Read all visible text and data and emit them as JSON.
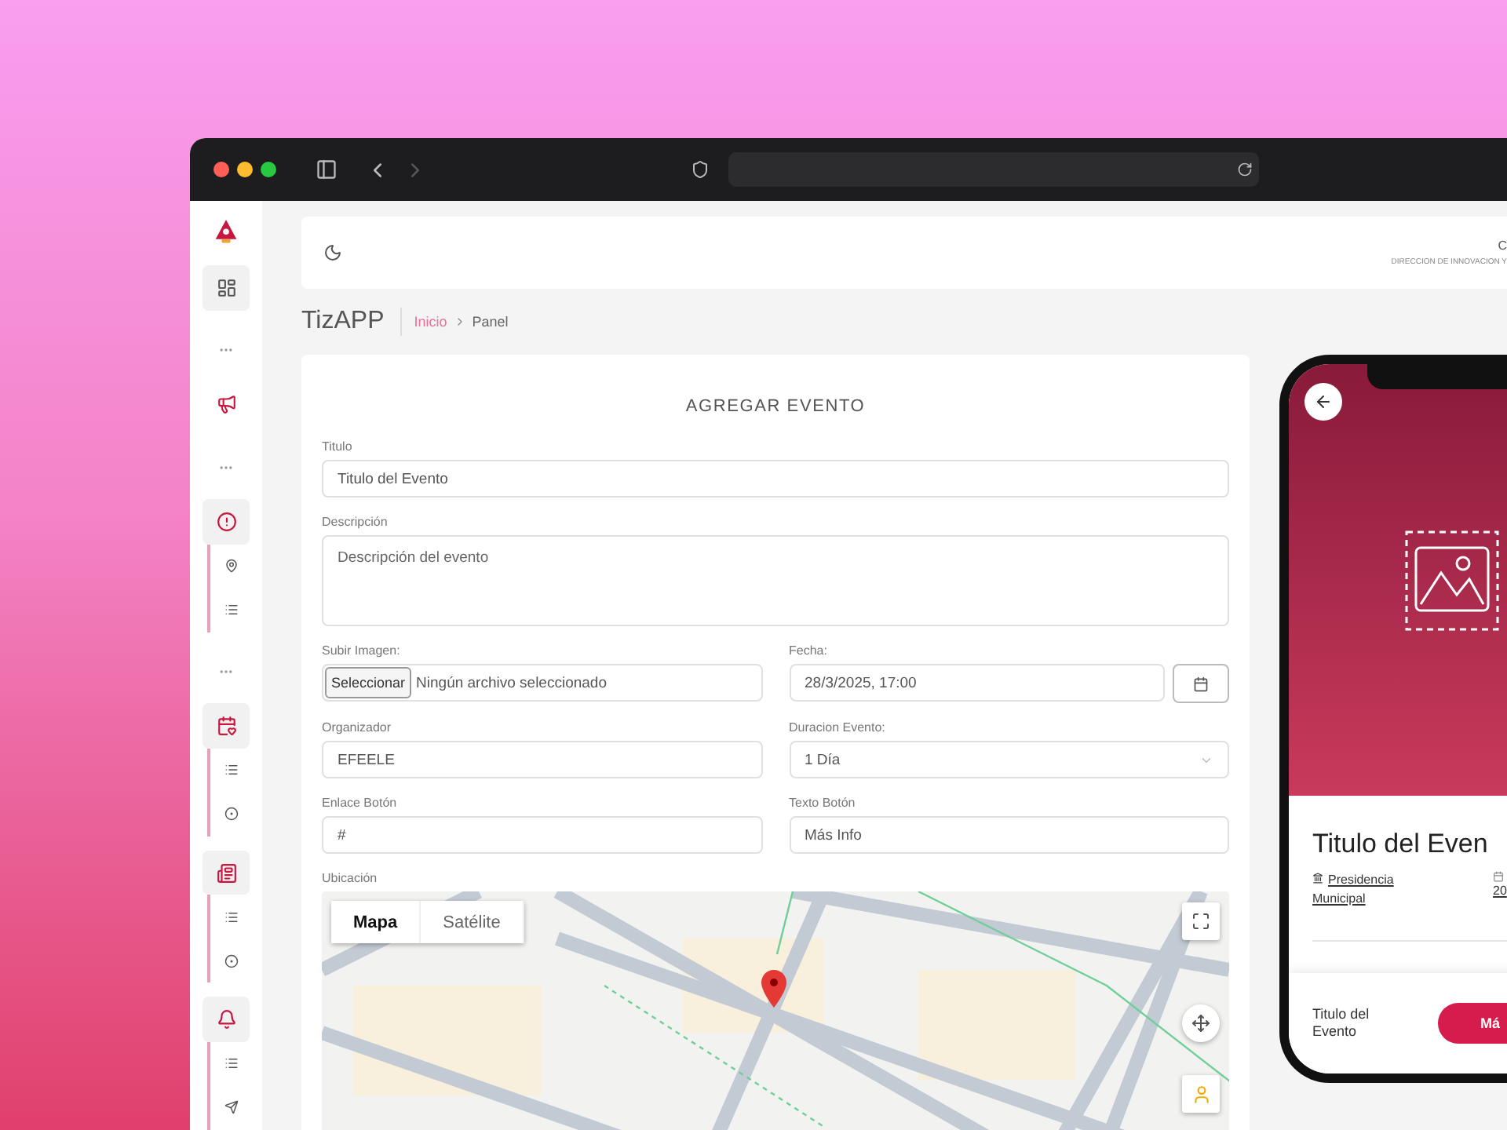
{
  "header": {
    "org_initial": "C",
    "org_subtitle": "DIRECCION DE INNOVACION Y"
  },
  "nav": [
    {
      "kind": "link",
      "selected": true
    },
    {
      "kind": "separator"
    },
    {
      "kind": "link",
      "selected": false
    },
    {
      "kind": "separator"
    },
    {
      "kind": "group",
      "expanded": true,
      "children": [
        {
          "selected": false
        },
        {
          "selected": false
        }
      ]
    },
    {
      "kind": "separator"
    },
    {
      "kind": "group",
      "expanded": true,
      "children": [
        {
          "selected": false
        },
        {
          "selected": false
        }
      ]
    },
    {
      "kind": "group",
      "expanded": true,
      "children": [
        {
          "selected": false
        },
        {
          "selected": false
        }
      ]
    },
    {
      "kind": "group",
      "expanded": true,
      "children": [
        {
          "selected": false
        },
        {
          "selected": false
        }
      ]
    }
  ],
  "breadcrumb": {
    "app": "TizAPP",
    "items": [
      {
        "label": "Inicio",
        "kind": "link"
      },
      {
        "label": "Panel",
        "kind": "current"
      }
    ]
  },
  "form": {
    "title": "AGREGAR EVENTO",
    "rows": [
      [
        {
          "kind": "text",
          "label": "Titulo",
          "value": "Titulo del Evento"
        }
      ],
      [
        {
          "kind": "textarea",
          "label": "Descripción",
          "placeholder": "Descripción del evento"
        }
      ],
      [
        {
          "kind": "file",
          "label": "Subir Imagen:",
          "button": "Seleccionar",
          "value": "Ningún archivo seleccionado"
        },
        {
          "kind": "datetime",
          "label": "Fecha:",
          "value": "28/3/2025, 17:00"
        }
      ],
      [
        {
          "kind": "text",
          "label": "Organizador",
          "value": "EFEELE"
        },
        {
          "kind": "select",
          "label": "Duracion Evento:",
          "value": "1 Día"
        }
      ],
      [
        {
          "kind": "text",
          "label": "Enlace Botón",
          "value": "#"
        },
        {
          "kind": "text",
          "label": "Texto Botón",
          "value": "Más Info"
        }
      ]
    ],
    "map": {
      "label": "Ubicación",
      "map_types": [
        {
          "label": "Mapa",
          "selected": true
        },
        {
          "label": "Satélite",
          "selected": false
        }
      ]
    }
  },
  "preview": {
    "title": "Titulo del Even",
    "location": "Presidencia Municipal",
    "date": "20",
    "footer_title": "Titulo del Evento",
    "button": "Má"
  }
}
